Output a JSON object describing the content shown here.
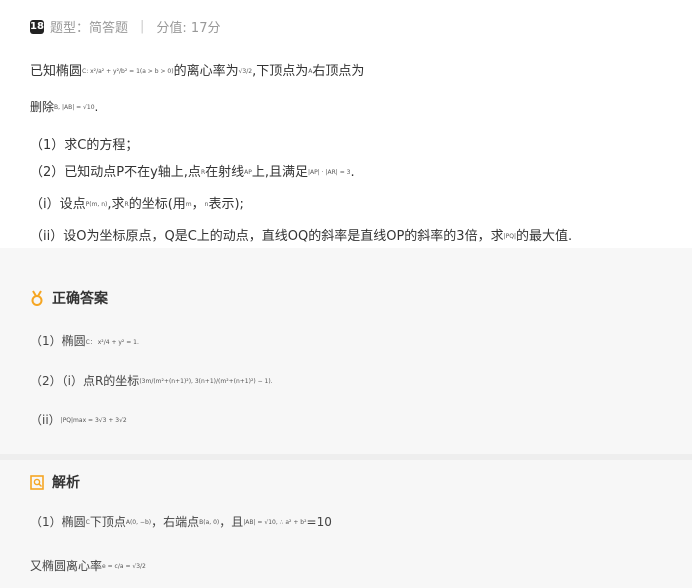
{
  "header": {
    "number": "18",
    "type_label": "题型：简答题",
    "separator": "|",
    "score_label": "分值: 17分"
  },
  "question": {
    "line1_pre": "已知椭圆",
    "line1_formula": "C: x²/a² + y²/b² = 1(a > b > 0)",
    "line1_mid": "的离心率为",
    "line1_ecc": "√3/2",
    "line1_post": ",下顶点为",
    "line1_a": "A",
    "line1_end": "右顶点为",
    "line2_pre": "删除",
    "line2_formula": "B, |AB| = √10",
    "line2_end": ".",
    "q1": "（1）求C的方程；",
    "q2_pre": "（2）已知动点P不在y轴上,点",
    "q2_r": "R",
    "q2_mid": "在射线",
    "q2_ap": "AP",
    "q2_post": "上,且满足",
    "q2_formula": "|AP| · |AR| = 3",
    "q2_end": ".",
    "qi_pre": "（i）设点",
    "qi_p": "P(m, n)",
    "qi_mid": ",求",
    "qi_r": "R",
    "qi_post": "的坐标(用",
    "qi_m": "m",
    "qi_comma": "，",
    "qi_n": "n",
    "qi_end": "表示);",
    "qii_pre": "（ii）设O为坐标原点，Q是C上的动点，直线OQ的斜率是直线OP的斜率的3倍，求",
    "qii_pq": "|PQ|",
    "qii_end": "的最大值."
  },
  "answer": {
    "title": "正确答案",
    "a1_pre": "（1）椭圆",
    "a1_formula": "C： x²/4 + y² = 1.",
    "a2_pre": "（2）（i）点R的坐标",
    "a2_formula": "(3m/(m²+(n+1)²), 3(n+1)/(m²+(n+1)²) − 1).",
    "a3_pre": "（ii）",
    "a3_formula": "|PQ|max = 3√3 + 3√2"
  },
  "analysis": {
    "title": "解析",
    "b1_pre": "（1）椭圆",
    "b1_c": "C",
    "b1_mid": "下顶点",
    "b1_a": "A(0, −b)",
    "b1_mid2": "，右端点",
    "b1_b": "B(a, 0)",
    "b1_mid3": "，且",
    "b1_formula": "|AB| = √10, ∴ a² + b²",
    "b1_end": "=10",
    "b2_pre": "又椭圆离心率",
    "b2_formula": "e = c/a = √3/2"
  }
}
